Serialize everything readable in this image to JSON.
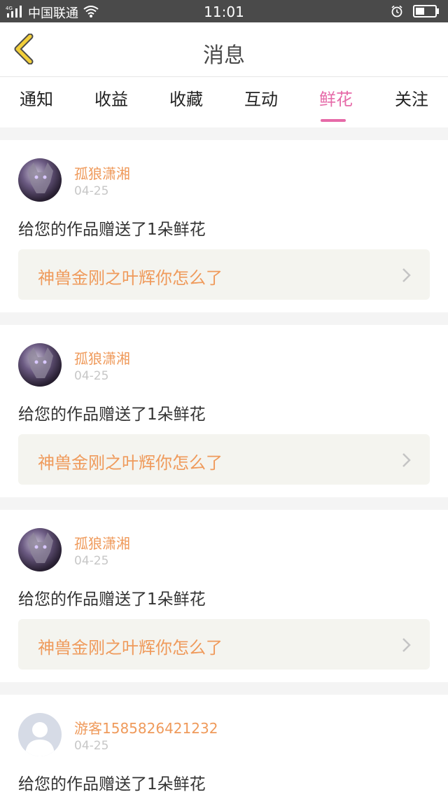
{
  "status_bar": {
    "network": "4G",
    "carrier": "中国联通",
    "time": "11:01"
  },
  "header": {
    "title": "消息"
  },
  "tabs": [
    {
      "label": "通知",
      "active": false
    },
    {
      "label": "收益",
      "active": false
    },
    {
      "label": "收藏",
      "active": false
    },
    {
      "label": "互动",
      "active": false
    },
    {
      "label": "鲜花",
      "active": true
    },
    {
      "label": "关注",
      "active": false
    }
  ],
  "items": [
    {
      "user": "孤狼潇湘",
      "date": "04-25",
      "message": "给您的作品赠送了1朵鲜花",
      "work": "神兽金刚之叶辉你怎么了"
    },
    {
      "user": "孤狼潇湘",
      "date": "04-25",
      "message": "给您的作品赠送了1朵鲜花",
      "work": "神兽金刚之叶辉你怎么了"
    },
    {
      "user": "孤狼潇湘",
      "date": "04-25",
      "message": "给您的作品赠送了1朵鲜花",
      "work": "神兽金刚之叶辉你怎么了"
    },
    {
      "user": "游客1585826421232",
      "date": "04-25",
      "message": "给您的作品赠送了1朵鲜花"
    }
  ],
  "colors": {
    "accent": "#e66aa8",
    "username": "#ef9a5b",
    "back_arrow": "#f2cf3a"
  }
}
